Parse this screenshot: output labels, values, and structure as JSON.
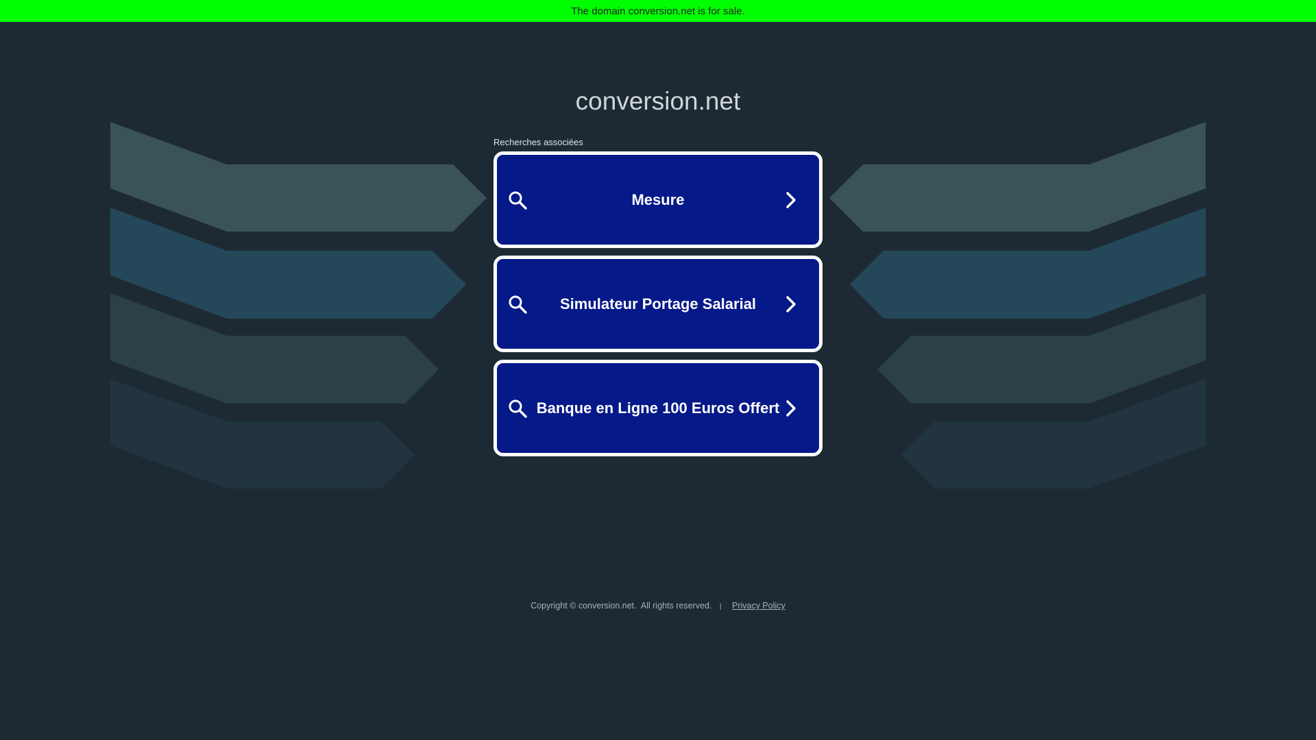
{
  "banner": {
    "text": "The domain conversion.net is for sale."
  },
  "site": {
    "title": "conversion.net"
  },
  "related": {
    "label": "Recherches associées",
    "links": [
      {
        "label": "Mesure"
      },
      {
        "label": "Simulateur Portage Salarial"
      },
      {
        "label": "Banque en Ligne 100 Euros Offert"
      }
    ]
  },
  "footer": {
    "copyright": "Copyright © conversion.net.  All rights reserved.",
    "separator": "|",
    "privacy_label": "Privacy Policy"
  },
  "icons": {
    "search": "search-icon",
    "chevron": "chevron-right-icon"
  },
  "colors": {
    "background": "#1e2a33",
    "banner": "#00ff00",
    "button": "#061988",
    "button_border": "#ffffff",
    "decor_row_1": "#3a5358",
    "decor_row_2": "#24485a",
    "decor_row_3": "#2b4047",
    "decor_row_4": "#213440"
  }
}
